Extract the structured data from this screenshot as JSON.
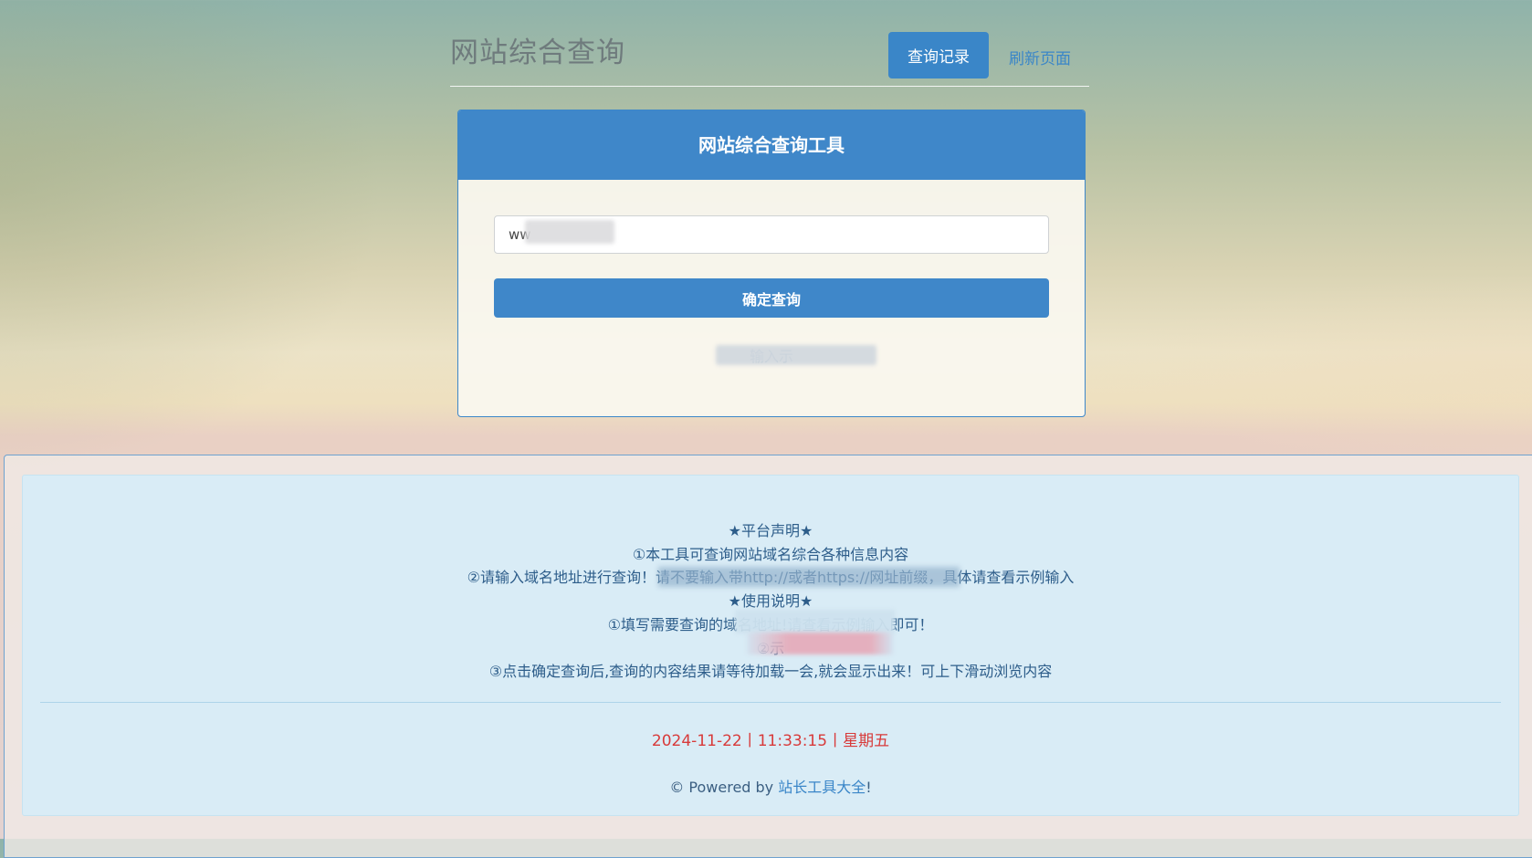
{
  "header": {
    "title": "网站综合查询",
    "records_button": "查询记录",
    "refresh_link": "刷新页面"
  },
  "query_panel": {
    "heading": "网站综合查询工具",
    "input_value": "ww",
    "submit_button": "确定查询",
    "example_hint": "输入示"
  },
  "notice": {
    "title": "★平台声明★",
    "line1": "①本工具可查询网站域名综合各种信息内容",
    "line2": "②请输入域名地址进行查询！请不要输入带http://或者https://网址前缀，具体请查看示例输入",
    "usage_title": "★使用说明★",
    "usage1": "①填写需要查询的域名地址!请查看示例输入即可！",
    "usage2": "②示",
    "usage3": "③点击确定查询后,查询的内容结果请等待加载一会,就会显示出来！可上下滑动浏览内容"
  },
  "footer": {
    "datetime": "2024-11-22丨11:33:15丨星期五",
    "powered_prefix": "© Powered by ",
    "powered_link": "站长工具大全",
    "powered_suffix": "!"
  },
  "colors": {
    "accent": "#3f87c9",
    "datetime": "#d83a3a",
    "footer_bg": "#d9ecf6"
  }
}
